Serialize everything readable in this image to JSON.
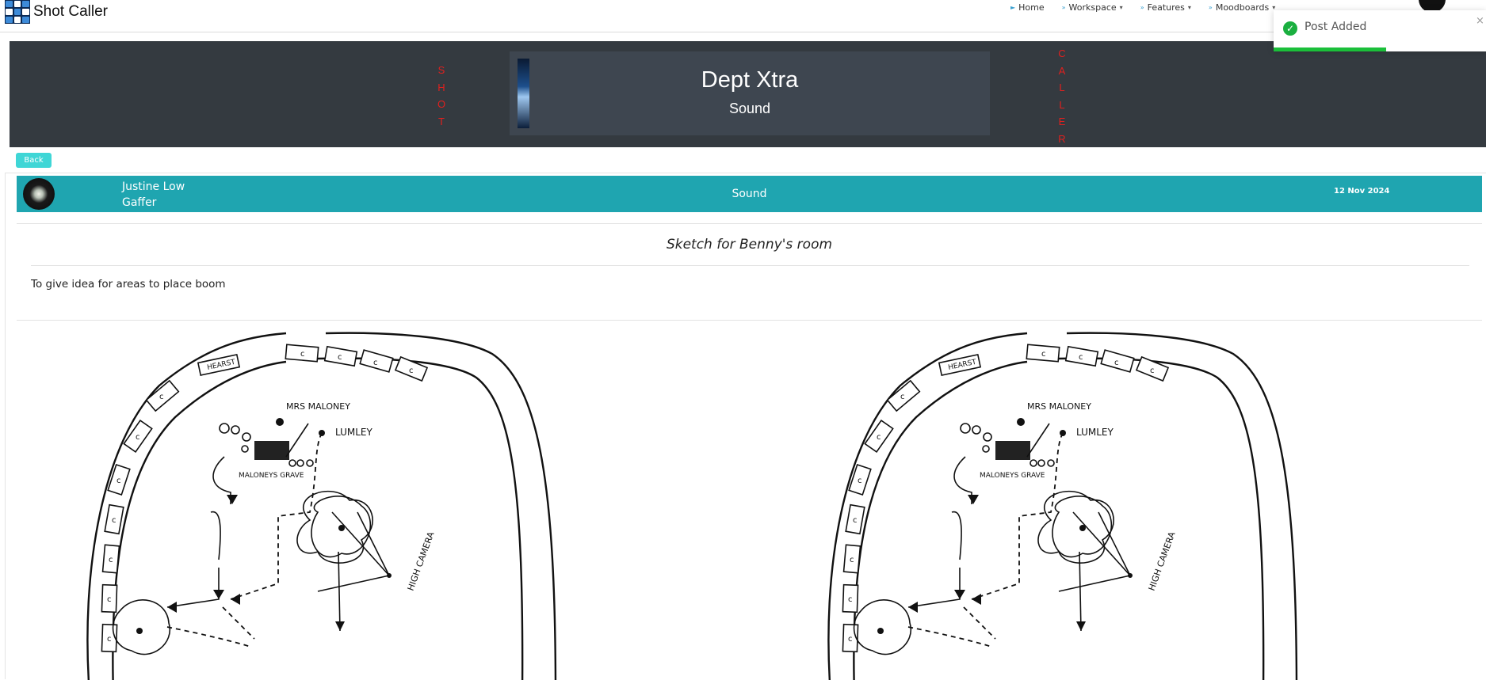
{
  "app": {
    "name": "Shot Caller"
  },
  "nav": {
    "items": [
      {
        "label": "Home",
        "caret": ""
      },
      {
        "label": "Workspace",
        "caret": "▾"
      },
      {
        "label": "Features",
        "caret": "▾"
      },
      {
        "label": "Moodboards",
        "caret": "▾"
      }
    ]
  },
  "hero": {
    "left_vertical": "SHOT",
    "right_vertical": "CALLER",
    "title": "Dept Xtra",
    "subtitle": "Sound"
  },
  "back_label": "Back",
  "post": {
    "author": "Justine Low",
    "role": "Gaffer",
    "department": "Sound",
    "date": "12 Nov 2024",
    "title": "Sketch for Benny's room",
    "body": "To give idea for areas to place boom"
  },
  "sketch_labels": {
    "hearse": "HEARST",
    "mrs_maloney": "MRS MALONEY",
    "lumley": "LUMLEY",
    "maloneys_grave": "MALONEYS GRAVE",
    "high_camera": "HIGH CAMERA",
    "chair": "c"
  },
  "toast": {
    "message": "Post Added",
    "close": "×",
    "progress_fraction": 0.53
  },
  "colors": {
    "hero_bg": "#343a40",
    "accent_teal": "#1fa5b0",
    "back_button": "#3fd6d6",
    "vertical_text": "#e0201e",
    "toast_success": "#1aaf3f"
  }
}
